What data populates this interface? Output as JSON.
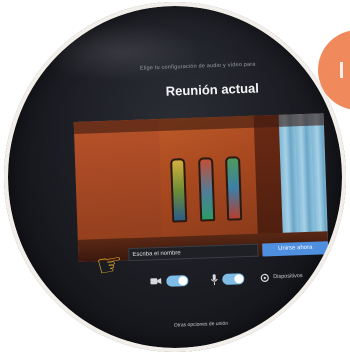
{
  "prompt_text": "Elige tu configuración de audio y vídeo para",
  "meeting_title": "Reunión actual",
  "name_input": {
    "placeholder": "Escriba el nombre",
    "value": ""
  },
  "join_button_label": "Unirse ahora",
  "controls": {
    "camera_toggle_on": true,
    "mic_toggle_on": true,
    "devices_label": "Dispositivos"
  },
  "other_options_label": "Otras opciones de unión",
  "icons": {
    "camera": "camera-icon",
    "microphone": "microphone-icon",
    "devices": "gear-icon",
    "pointer": "pointing-hand-icon"
  },
  "colors": {
    "accent": "#4f8fe0",
    "toggle_on": "#7fbde6",
    "badge": "#f08a5d",
    "background": "#1a1b21"
  }
}
